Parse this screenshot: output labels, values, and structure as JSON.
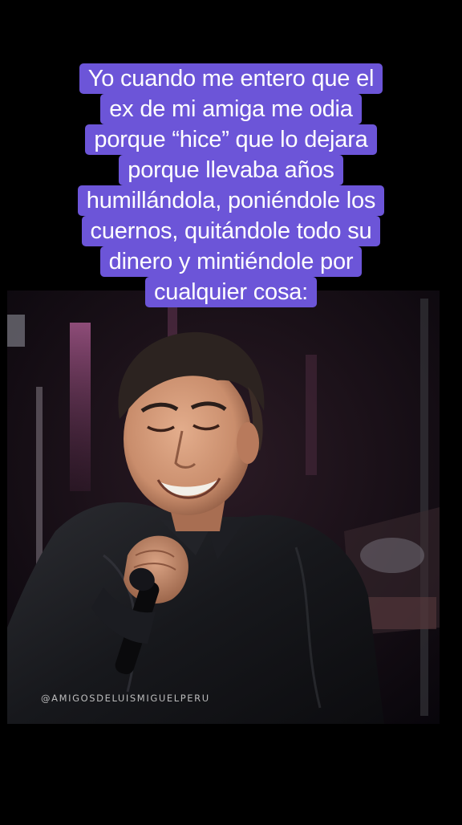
{
  "caption": {
    "lines": [
      "Yo cuando me entero que el",
      "ex de mi amiga me odia",
      "porque “hice” que lo dejara",
      "porque llevaba años",
      "humillándola, poniéndole los",
      "cuernos, quitándole todo su",
      "dinero  y mintiéndole por",
      "cualquier cosa:"
    ],
    "background_color": "#6c55d8",
    "text_color": "#ffffff"
  },
  "video": {
    "watermark": "@AMIGOSDELUISMIGUELPERU"
  }
}
